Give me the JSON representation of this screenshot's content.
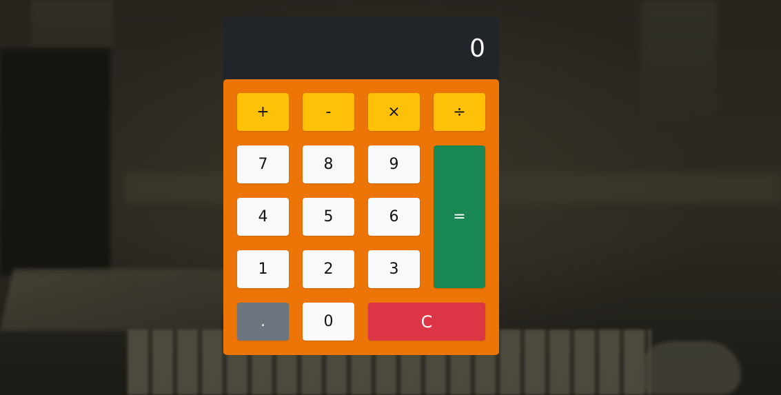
{
  "display": {
    "value": "0"
  },
  "operators": {
    "add": "+",
    "subtract": "-",
    "multiply": "×",
    "divide": "÷"
  },
  "digits": {
    "seven": "7",
    "eight": "8",
    "nine": "9",
    "four": "4",
    "five": "5",
    "six": "6",
    "one": "1",
    "two": "2",
    "three": "3",
    "zero": "0"
  },
  "actions": {
    "equals": "=",
    "decimal": ".",
    "clear": "C"
  },
  "colors": {
    "display_background": "#212529",
    "keypad_background": "#ed7507",
    "operator_key": "#ffc107",
    "digit_key": "#f8f9fa",
    "equals_key": "#198754",
    "decimal_key": "#6c757d",
    "clear_key": "#dc3545"
  }
}
